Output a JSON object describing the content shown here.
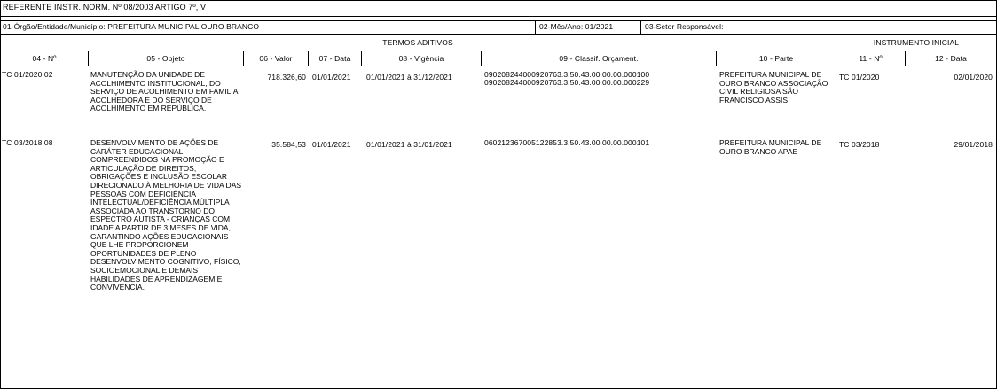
{
  "header": {
    "reference": "REFERENTE  INSTR. NORM. Nº 08/2003 ARTIGO 7º, V",
    "orgao": "01-Órgão/Entidade/Município: PREFEITURA MUNICIPAL OURO BRANCO",
    "mes_ano": "02-Mês/Ano: 01/2021",
    "setor": "03-Setor Responsável:"
  },
  "groups": {
    "termos_aditivos": "TERMOS ADITIVOS",
    "instrumento_inicial": "INSTRUMENTO INICIAL"
  },
  "columns": {
    "numero": "04 - Nº",
    "objeto": "05 - Objeto",
    "valor": "06 - Valor",
    "data": "07 - Data",
    "vigencia": "08 - Vigência",
    "classif": "09 - Classif. Orçament.",
    "parte": "10 - Parte",
    "inicial_numero": "11 - Nº",
    "inicial_data": "12 - Data"
  },
  "rows": [
    {
      "numero": "TC 01/2020 02",
      "objeto": "MANUTENÇÃO DA UNIDADE DE ACOLHIMENTO INSTITUCIONAL, DO SERVIÇO DE ACOLHIMENTO EM FAMILIA ACOLHEDORA E DO SERVIÇO DE ACOLHIMENTO EM REPÚBLICA.",
      "valor": "718.326,60",
      "data": "01/01/2021",
      "vigencia": "01/01/2021  à  31/12/2021",
      "classif_1": "090208244000920763.3.50.43.00.00.00.000100",
      "classif_2": "090208244000920763.3.50.43.00.00.00.000229",
      "parte": "PREFEITURA MUNICIPAL DE OURO BRANCO ASSOCIAÇÃO CIVIL RELIGIOSA SÃO FRANCISCO ASSIS",
      "inicial_numero": "TC 01/2020",
      "inicial_data": "02/01/2020"
    },
    {
      "numero": "TC 03/2018 08",
      "objeto": "DESENVOLVIMENTO DE AÇÕES DE CARÁTER EDUCACIONAL COMPREENDIDOS NA PROMOÇÃO E ARTICULAÇÃO DE DIREITOS, OBRIGAÇÕES E INCLUSÃO ESCOLAR DIRECIONADO À MELHORIA DE VIDA DAS PESSOAS COM DEFICIÊNCIA INTELECTUAL/DEFICIÊNCIA MÚLTIPLA ASSOCIADA AO TRANSTORNO DO ESPECTRO AUTISTA - CRIANÇAS COM IDADE A PARTIR DE 3 MESES DE VIDA, GARANTINDO AÇÕES EDUCACIONAIS QUE LHE PROPORCIONEM OPORTUNIDADES DE PLENO DESENVOLVIMENTO COGNITIVO, FÍSICO, SOCIOEMOCIONAL E DEMAIS HABILIDADES DE APRENDIZAGEM E CONVIVÊNCIA.",
      "valor": "35.584,53",
      "data": "01/01/2021",
      "vigencia": "01/01/2021  à  31/01/2021",
      "classif_1": "060212367005122853.3.50.43.00.00.00.000101",
      "classif_2": "",
      "parte": "PREFEITURA MUNICIPAL DE OURO BRANCO APAE",
      "inicial_numero": "TC 03/2018",
      "inicial_data": "29/01/2018"
    }
  ]
}
